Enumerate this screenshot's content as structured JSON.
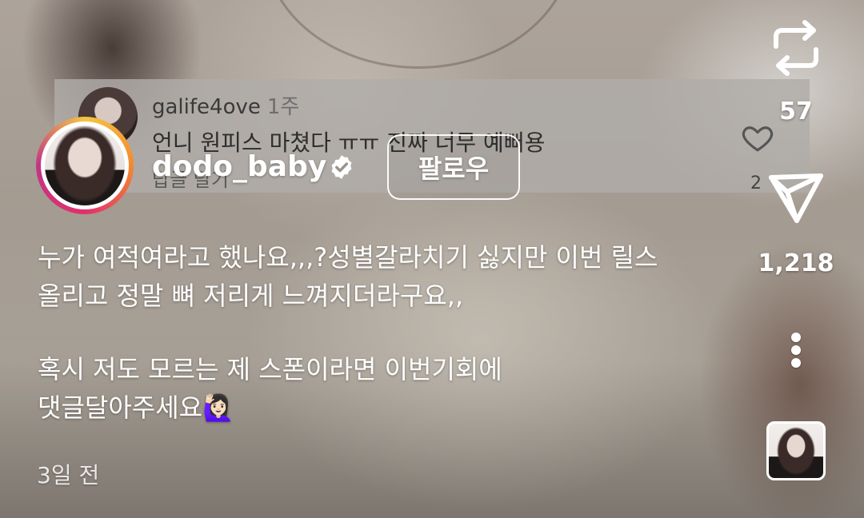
{
  "comment_overlay": {
    "username": "galife4ove",
    "time": "1주",
    "text": "언니 원피스 마쳤다 ㅠㅠ 진짜 너무 예뻐용",
    "reply_label": "답글 달기",
    "likes": "2"
  },
  "author": {
    "username": "dodo_baby",
    "verified": true,
    "follow_label": "팔로우"
  },
  "caption": {
    "lines": [
      "누가 여적여라고 했나요,,,?성별갈라치기 싫지만 이번 릴스",
      "올리고 정말 뼈 저리게 느껴지더라구요,,",
      "혹시 저도 모르는 제 스폰이라면 이번기회에",
      "댓글달아주세요🙋🏻‍♀️"
    ],
    "time_ago": "3일 전"
  },
  "actions": {
    "repost_icon": "repost-icon",
    "repost_count": "57",
    "share_icon": "send-icon",
    "share_count": "1,218",
    "more_icon": "more-vertical-icon"
  },
  "colors": {
    "ring_gradient": [
      "#f5c542",
      "#f28a2e",
      "#e1306c",
      "#c13584"
    ],
    "text": "#ffffff",
    "verified_badge": "#ffffff"
  }
}
